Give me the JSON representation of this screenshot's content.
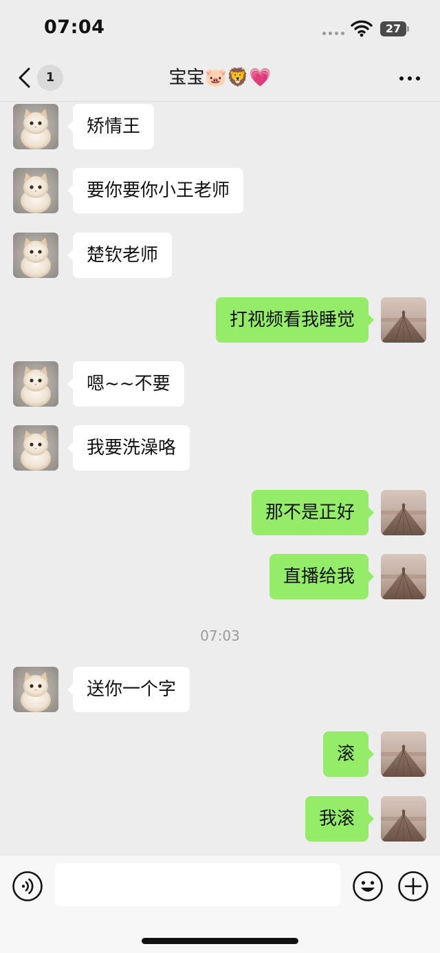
{
  "status_bar": {
    "time": "07:04",
    "battery_level": "27"
  },
  "header": {
    "back_badge": "1",
    "title": "宝宝🐷🦁💗",
    "more_icon": "more-icon"
  },
  "messages": [
    {
      "side": "in",
      "text": "矫情王"
    },
    {
      "side": "in",
      "text": "要你要你小王老师"
    },
    {
      "side": "in",
      "text": "楚钦老师"
    },
    {
      "side": "out",
      "text": "打视频看我睡觉"
    },
    {
      "side": "in",
      "text": "嗯~~不要"
    },
    {
      "side": "in",
      "text": "我要洗澡咯"
    },
    {
      "side": "out",
      "text": "那不是正好"
    },
    {
      "side": "out",
      "text": "直播给我"
    },
    {
      "side": "in",
      "text": "送你一个字"
    },
    {
      "side": "out",
      "text": "滚"
    },
    {
      "side": "out",
      "text": "我滚"
    }
  ],
  "time_divider": "07:03",
  "input_bar": {
    "voice_icon": "voice-icon",
    "emoji_icon": "emoji-icon",
    "plus_icon": "plus-icon",
    "input_value": ""
  },
  "colors": {
    "background": "#ededed",
    "outgoing_bubble": "#95ec69",
    "incoming_bubble": "#ffffff"
  }
}
